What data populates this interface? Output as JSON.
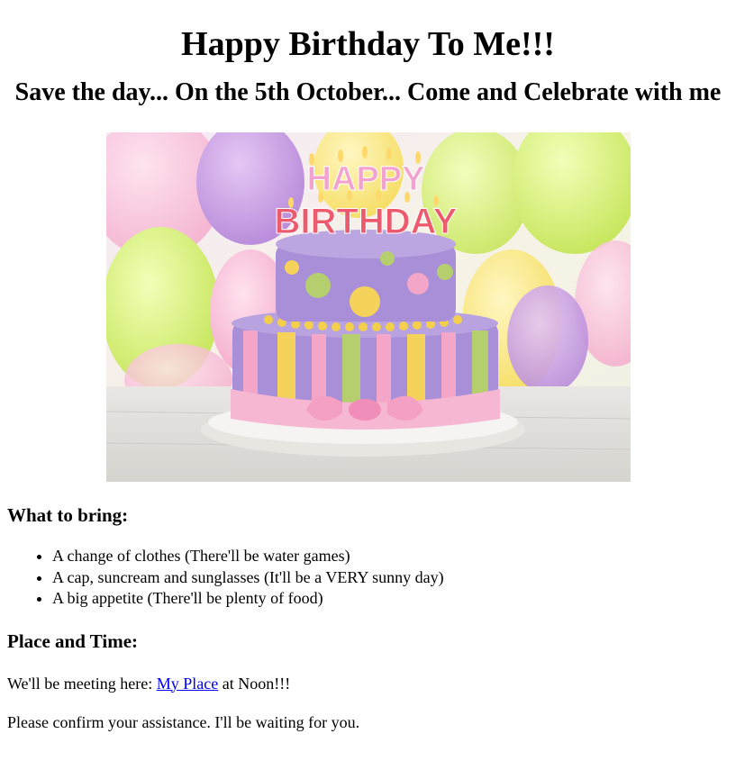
{
  "header": {
    "title": "Happy Birthday To Me!!!",
    "subtitle": "Save the day... On the 5th October... Come and Celebrate with me"
  },
  "hero_image": {
    "cake_text_line1": "HAPPY",
    "cake_text_line2": "BIRTHDAY",
    "colors": {
      "purple": "#a98fd8",
      "pink": "#f3a6c8",
      "yellow": "#f5d25a",
      "green": "#b6cf6e",
      "board": "#f4f1ee"
    }
  },
  "bring": {
    "heading": "What to bring:",
    "items": [
      "A change of clothes (There'll be water games)",
      "A cap, suncream and sunglasses (It'll be a VERY sunny day)",
      "A big appetite (There'll be plenty of food)"
    ]
  },
  "place": {
    "heading": "Place and Time:",
    "meet_prefix": "We'll be meeting here: ",
    "link_text": "My Place",
    "meet_suffix": " at Noon!!!"
  },
  "confirm_text": "Please confirm your assistance. I'll be waiting for you."
}
